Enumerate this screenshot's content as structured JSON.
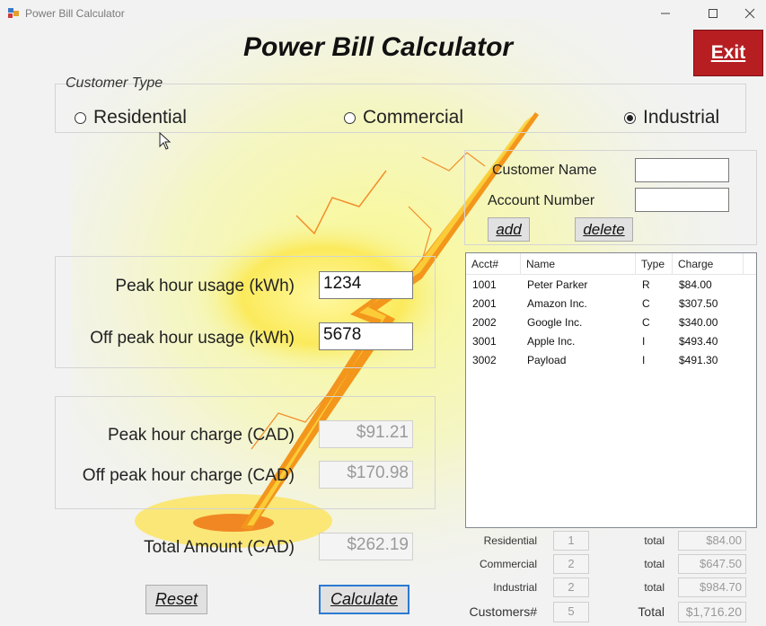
{
  "window": {
    "title": "Power Bill Calculator"
  },
  "header": {
    "title": "Power Bill Calculator",
    "exit_label": "Exit"
  },
  "customer_type": {
    "legend": "Customer Type",
    "options": [
      {
        "label": "Residential",
        "checked": false
      },
      {
        "label": "Commercial",
        "checked": false
      },
      {
        "label": "Industrial",
        "checked": true
      }
    ]
  },
  "customer": {
    "name_label": "Customer Name",
    "name_value": "",
    "account_label": "Account Number",
    "account_value": "",
    "add_label": "add",
    "delete_label": "delete"
  },
  "usage": {
    "peak_label": "Peak hour usage (kWh)",
    "peak_value": "1234",
    "offpeak_label": "Off peak hour usage (kWh)",
    "offpeak_value": "5678"
  },
  "charges": {
    "peak_label": "Peak hour charge (CAD)",
    "peak_value": "$91.21",
    "offpeak_label": "Off peak hour charge (CAD)",
    "offpeak_value": "$170.98",
    "total_label": "Total Amount (CAD)",
    "total_value": "$262.19"
  },
  "buttons": {
    "reset_label": "Reset",
    "calculate_label": "Calculate"
  },
  "list": {
    "columns": [
      "Acct#",
      "Name",
      "Type",
      "Charge"
    ],
    "rows": [
      [
        "1001",
        "Peter Parker",
        "R",
        "$84.00"
      ],
      [
        "2001",
        "Amazon Inc.",
        "C",
        "$307.50"
      ],
      [
        "2002",
        "Google Inc.",
        "C",
        "$340.00"
      ],
      [
        "3001",
        "Apple Inc.",
        "I",
        "$493.40"
      ],
      [
        "3002",
        "Payload",
        "I",
        "$491.30"
      ]
    ]
  },
  "summary": {
    "rows": [
      {
        "label": "Residential",
        "count": "1",
        "total_label": "total",
        "total": "$84.00"
      },
      {
        "label": "Commercial",
        "count": "2",
        "total_label": "total",
        "total": "$647.50"
      },
      {
        "label": "Industrial",
        "count": "2",
        "total_label": "total",
        "total": "$984.70"
      }
    ],
    "customers_label": "Customers#",
    "customers_count": "5",
    "grand_total_label": "Total",
    "grand_total": "$1,716.20"
  },
  "icons": {
    "app": "power-bill-app-icon",
    "cursor": "mouse-pointer-icon"
  },
  "colors": {
    "exit_button": "#b61e22",
    "focus_border": "#2a7ad2"
  }
}
